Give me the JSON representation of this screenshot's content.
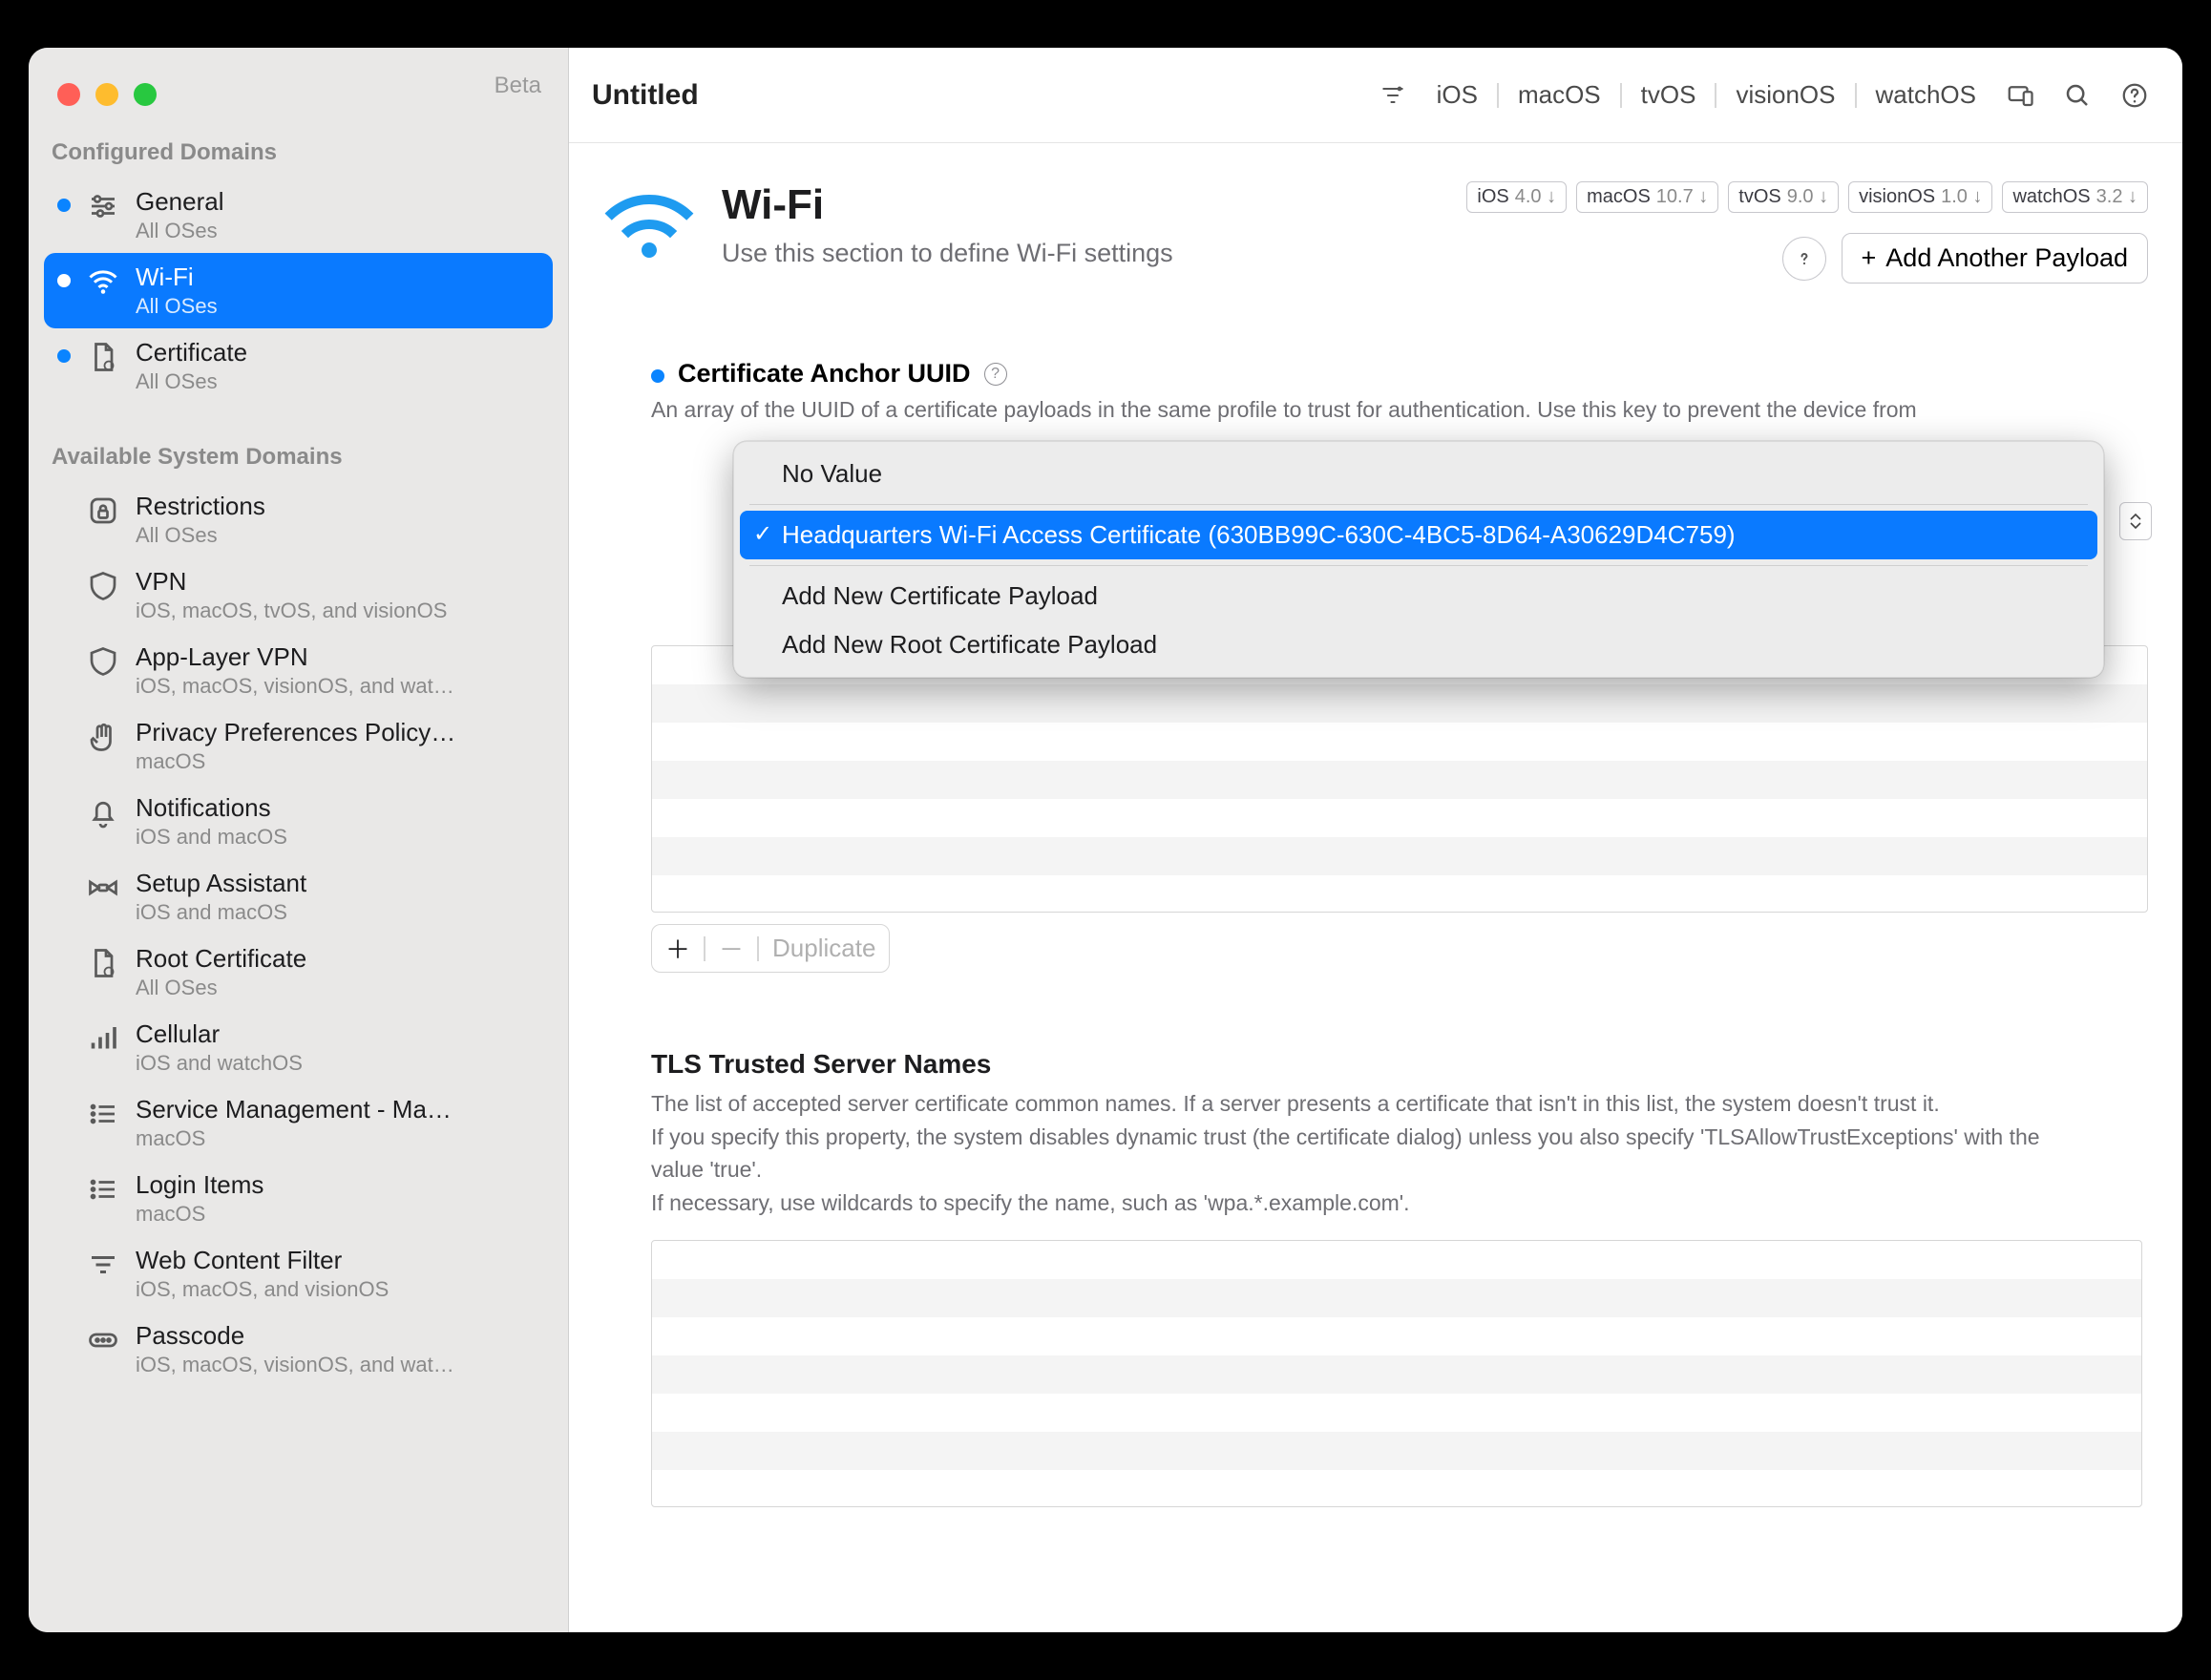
{
  "window": {
    "title": "Untitled",
    "beta_label": "Beta"
  },
  "toolbar_os": [
    "iOS",
    "macOS",
    "tvOS",
    "visionOS",
    "watchOS"
  ],
  "sidebar": {
    "configured_label": "Configured Domains",
    "available_label": "Available System Domains",
    "configured": [
      {
        "title": "General",
        "sub": "All OSes",
        "icon": "sliders"
      },
      {
        "title": "Wi-Fi",
        "sub": "All OSes",
        "selected": true,
        "icon": "wifi"
      },
      {
        "title": "Certificate",
        "sub": "All OSes",
        "icon": "cert"
      }
    ],
    "available": [
      {
        "title": "Restrictions",
        "sub": "All OSes",
        "icon": "lock"
      },
      {
        "title": "VPN",
        "sub": "iOS, macOS, tvOS, and visionOS",
        "icon": "shield"
      },
      {
        "title": "App-Layer VPN",
        "sub": "iOS, macOS, visionOS, and wat…",
        "icon": "shieldo"
      },
      {
        "title": "Privacy Preferences Policy…",
        "sub": "macOS",
        "icon": "hand"
      },
      {
        "title": "Notifications",
        "sub": "iOS and macOS",
        "icon": "bell"
      },
      {
        "title": "Setup Assistant",
        "sub": "iOS and macOS",
        "icon": "bowtie"
      },
      {
        "title": "Root Certificate",
        "sub": "All OSes",
        "icon": "cert"
      },
      {
        "title": "Cellular",
        "sub": "iOS and watchOS",
        "icon": "bars"
      },
      {
        "title": "Service Management - Ma…",
        "sub": "macOS",
        "icon": "list"
      },
      {
        "title": "Login Items",
        "sub": "macOS",
        "icon": "list"
      },
      {
        "title": "Web Content Filter",
        "sub": "iOS, macOS, and visionOS",
        "icon": "filter"
      },
      {
        "title": "Passcode",
        "sub": "iOS, macOS, visionOS, and wat…",
        "icon": "passcode"
      }
    ]
  },
  "header": {
    "title": "Wi-Fi",
    "desc": "Use this section to define Wi-Fi settings",
    "badges": [
      {
        "os": "iOS",
        "ver": "4.0 ↓"
      },
      {
        "os": "macOS",
        "ver": "10.7 ↓"
      },
      {
        "os": "tvOS",
        "ver": "9.0 ↓"
      },
      {
        "os": "visionOS",
        "ver": "1.0 ↓"
      },
      {
        "os": "watchOS",
        "ver": "3.2 ↓"
      }
    ],
    "add_payload": "Add Another Payload"
  },
  "field1": {
    "title": "Certificate Anchor UUID",
    "desc": "An array of the UUID of a certificate payloads in the same profile to trust for authentication. Use this key to prevent the device from",
    "dropdown": {
      "no_value": "No Value",
      "selected": "Headquarters Wi-Fi Access Certificate (630BB99C-630C-4BC5-8D64-A30629D4C759)",
      "add_cert": "Add New Certificate Payload",
      "add_root": "Add New Root Certificate Payload"
    },
    "footer": {
      "plus": "＋",
      "minus": "－",
      "dup": "Duplicate"
    }
  },
  "field2": {
    "title": "TLS Trusted Server Names",
    "desc_lines": [
      "The list of accepted server certificate common names. If a server presents a certificate that isn't in this list, the system doesn't trust it.",
      "If you specify this property, the system disables dynamic trust (the certificate dialog) unless you also specify 'TLSAllowTrustExceptions' with the value 'true'.",
      "If necessary, use wildcards to specify the name, such as 'wpa.*.example.com'."
    ]
  }
}
